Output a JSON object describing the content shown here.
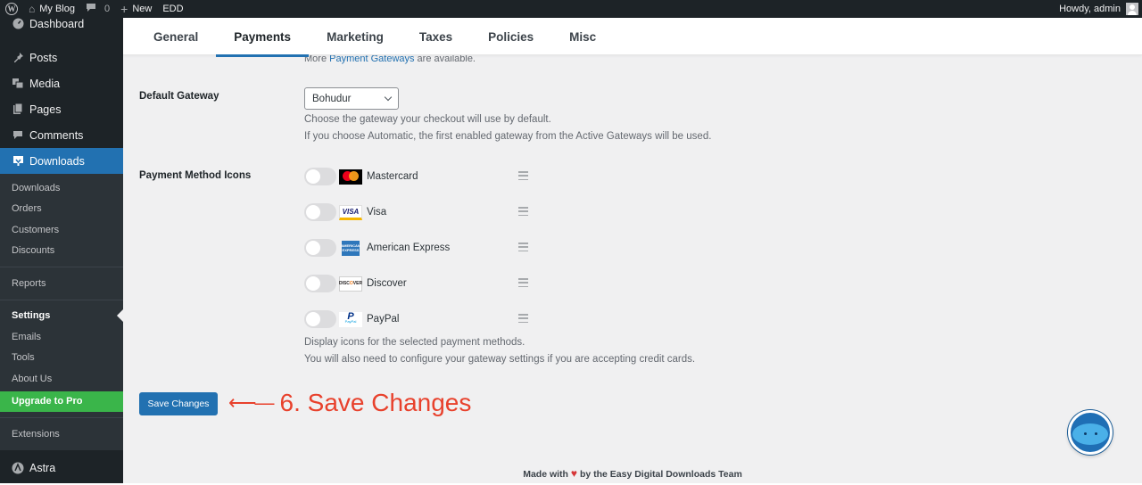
{
  "admin_bar": {
    "site_name": "My Blog",
    "comments_count": "0",
    "new_label": "New",
    "edd_label": "EDD",
    "howdy": "Howdy, admin"
  },
  "sidebar": {
    "top_item": "Dashboard",
    "items": [
      {
        "label": "Posts",
        "icon": "pin-icon"
      },
      {
        "label": "Media",
        "icon": "media-icon"
      },
      {
        "label": "Pages",
        "icon": "pages-icon"
      },
      {
        "label": "Comments",
        "icon": "comment-icon"
      },
      {
        "label": "Downloads",
        "icon": "download-icon"
      }
    ],
    "submenu": {
      "group1": [
        "Downloads",
        "Orders",
        "Customers",
        "Discounts"
      ],
      "reports": "Reports",
      "settings": "Settings",
      "group2": [
        "Emails",
        "Tools",
        "About Us"
      ],
      "upgrade": "Upgrade to Pro",
      "extensions": "Extensions"
    },
    "astra": "Astra"
  },
  "tabs": [
    "General",
    "Payments",
    "Marketing",
    "Taxes",
    "Policies",
    "Misc"
  ],
  "active_tab": "Payments",
  "partial_note": {
    "prefix": "More ",
    "link": "Payment Gateways",
    "suffix": " are available."
  },
  "default_gateway": {
    "label": "Default Gateway",
    "selected": "Bohudur",
    "desc_1": "Choose the gateway your checkout will use by default.",
    "desc_2": "If you choose Automatic, the first enabled gateway from the Active Gateways will be used."
  },
  "payment_icons": {
    "label": "Payment Method Icons",
    "methods": [
      {
        "label": "Mastercard",
        "icon": "mastercard-icon",
        "enabled": false
      },
      {
        "label": "Visa",
        "icon": "visa-icon",
        "enabled": false
      },
      {
        "label": "American Express",
        "icon": "amex-icon",
        "enabled": false
      },
      {
        "label": "Discover",
        "icon": "discover-icon",
        "enabled": false
      },
      {
        "label": "PayPal",
        "icon": "paypal-icon",
        "enabled": false
      }
    ],
    "card_text": {
      "visa": "VISA",
      "amex_1": "AMERICAN",
      "amex_2": "EXPRESS",
      "discover_a": "DISC",
      "discover_b": "O",
      "discover_c": "VER",
      "paypal_p": "P",
      "paypal_s": "PayPal"
    },
    "desc_1": "Display icons for the selected payment methods.",
    "desc_2": "You will also need to configure your gateway settings if you are accepting credit cards."
  },
  "save_button": "Save Changes",
  "annotation": "6. Save Changes",
  "footer": {
    "prefix": "Made with",
    "suffix": "by the Easy Digital Downloads Team"
  },
  "colors": {
    "accent": "#2271b1",
    "sidebar_bg": "#1d2327",
    "upgrade_green": "#3ab54a",
    "annotation_red": "#e8412c"
  }
}
